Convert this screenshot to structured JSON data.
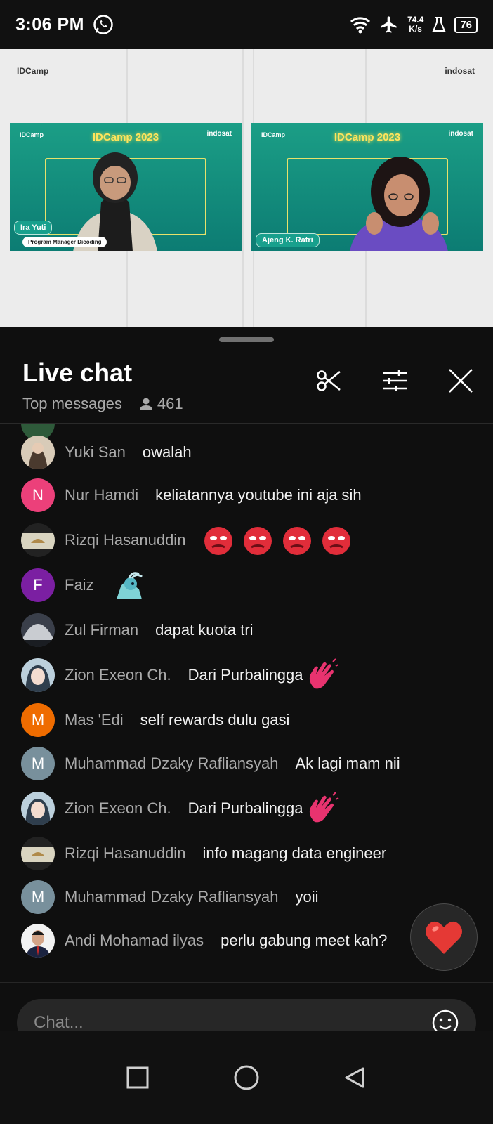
{
  "status_bar": {
    "time": "3:06 PM",
    "net_speed_value": "74.4",
    "net_speed_unit": "K/s",
    "battery": "76",
    "icons": [
      "whatsapp-icon",
      "wifi-icon",
      "airplane-icon",
      "flask-icon",
      "battery-icon"
    ]
  },
  "video": {
    "logo_left": "IDCamp",
    "logo_right": "indosat",
    "event_title": "IDCamp 2023",
    "speakers": [
      {
        "name": "Ira Yuti",
        "role": "Program Manager Dicoding"
      },
      {
        "name": "Ajeng K. Ratri",
        "role": ""
      }
    ]
  },
  "chat": {
    "title": "Live chat",
    "mode": "Top messages",
    "viewers": "461",
    "messages": [
      {
        "author": "Yuki San",
        "text": "owalah",
        "avatar_letter": "",
        "avatar_color": "#6b5a4a"
      },
      {
        "author": "Nur Hamdi",
        "text": "keliatannya youtube ini aja sih",
        "avatar_letter": "N",
        "avatar_color": "#ec407a"
      },
      {
        "author": "Rizqi Hasanuddin",
        "text": "",
        "avatar_letter": "",
        "avatar_color": "#8a8a7a"
      },
      {
        "author": "Faiz",
        "text": "",
        "avatar_letter": "F",
        "avatar_color": "#7b1fa2"
      },
      {
        "author": "Zul Firman",
        "text": "dapat kuota tri",
        "avatar_letter": "",
        "avatar_color": "#3a3f4a"
      },
      {
        "author": "Zion Exeon Ch.",
        "text": "Dari Purbalingga",
        "avatar_letter": "",
        "avatar_color": "#8fa6b8"
      },
      {
        "author": "Mas 'Edi",
        "text": "self rewards dulu gasi",
        "avatar_letter": "M",
        "avatar_color": "#ef6c00"
      },
      {
        "author": "Muhammad Dzaky Rafliansyah",
        "text": "Ak lagi mam nii",
        "avatar_letter": "M",
        "avatar_color": "#78909c"
      },
      {
        "author": "Zion Exeon Ch.",
        "text": "Dari Purbalingga",
        "avatar_letter": "",
        "avatar_color": "#8fa6b8"
      },
      {
        "author": "Rizqi Hasanuddin",
        "text": "info magang data engineer",
        "avatar_letter": "",
        "avatar_color": "#8a8a7a"
      },
      {
        "author": "Muhammad Dzaky Rafliansyah",
        "text": "yoii",
        "avatar_letter": "M",
        "avatar_color": "#78909c"
      },
      {
        "author": "Andi Mohamad ilyas",
        "text": "perlu gabung meet kah?",
        "avatar_letter": "",
        "avatar_color": "#e8e8e8"
      }
    ],
    "input_placeholder": "Chat..."
  },
  "colors": {
    "background": "#0f0f0f",
    "author_text": "#aaaaaa",
    "message_text": "#f1f1f1",
    "input_bg": "#272727",
    "heart": "#e53935"
  }
}
